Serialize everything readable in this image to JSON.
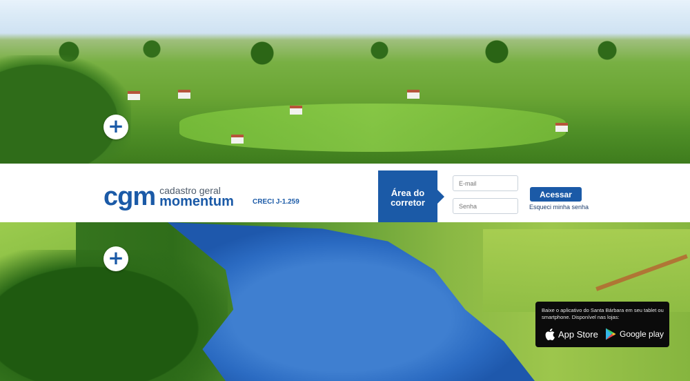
{
  "brand": {
    "logo_mark": "cgm",
    "line1": "cadastro geral",
    "line2": "momentum",
    "creci": "CRECI J-1.259"
  },
  "login": {
    "area_title": "Área do corretor",
    "email_placeholder": "E-mail",
    "password_placeholder": "Senha",
    "submit_label": "Acessar",
    "forgot_label": "Esqueci minha senha"
  },
  "plus_buttons": {
    "symbol": "+"
  },
  "app": {
    "description": "Baixe o aplicativo do Santa Bárbara em seu tablet ou smartphone. Disponível nas lojas:",
    "app_store_label": "App Store",
    "google_play_label": "Google play"
  },
  "colors": {
    "brand_blue": "#1b5aa7",
    "badge_bg": "#0b0b0b"
  }
}
